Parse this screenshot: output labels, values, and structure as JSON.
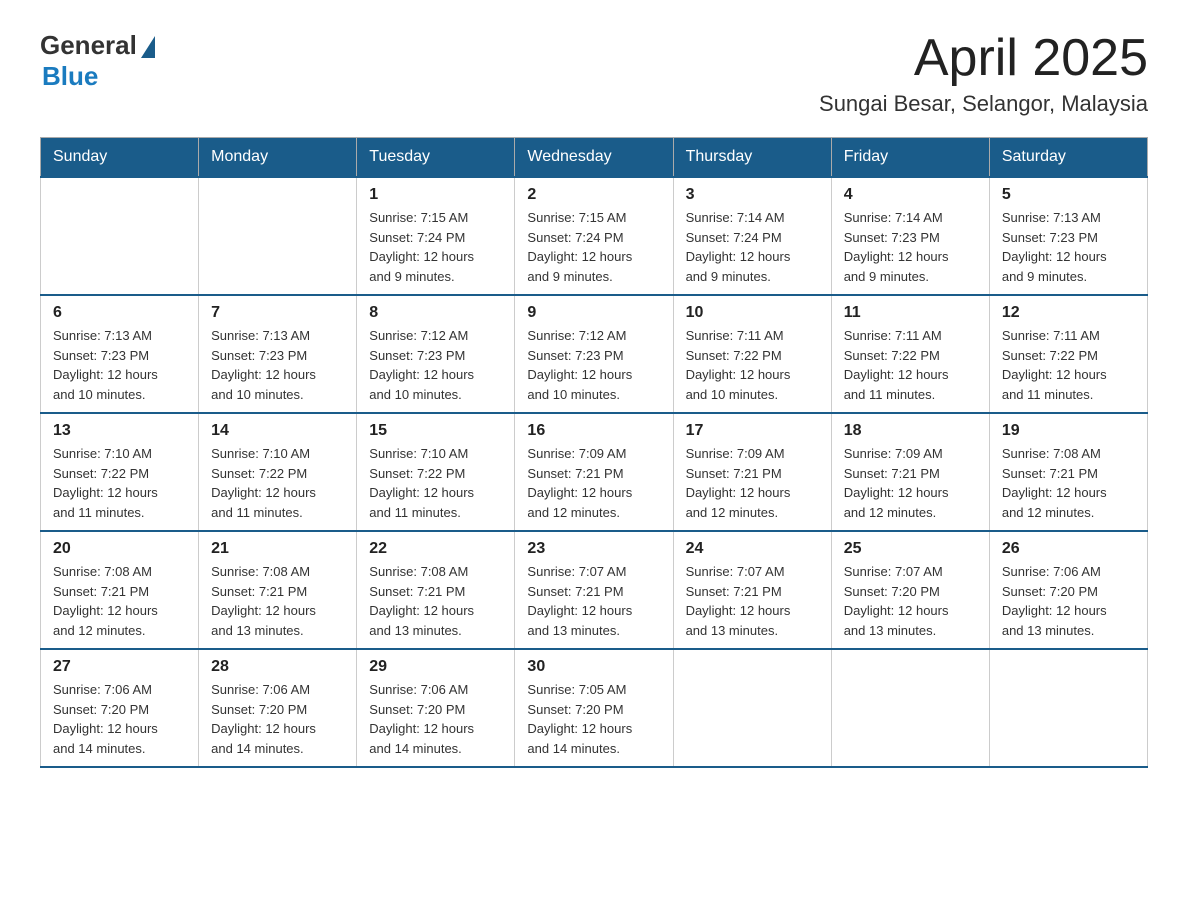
{
  "header": {
    "logo": {
      "general": "General",
      "blue": "Blue"
    },
    "title": "April 2025",
    "location": "Sungai Besar, Selangor, Malaysia"
  },
  "weekdays": [
    "Sunday",
    "Monday",
    "Tuesday",
    "Wednesday",
    "Thursday",
    "Friday",
    "Saturday"
  ],
  "weeks": [
    [
      {
        "day": "",
        "info": ""
      },
      {
        "day": "",
        "info": ""
      },
      {
        "day": "1",
        "info": "Sunrise: 7:15 AM\nSunset: 7:24 PM\nDaylight: 12 hours\nand 9 minutes."
      },
      {
        "day": "2",
        "info": "Sunrise: 7:15 AM\nSunset: 7:24 PM\nDaylight: 12 hours\nand 9 minutes."
      },
      {
        "day": "3",
        "info": "Sunrise: 7:14 AM\nSunset: 7:24 PM\nDaylight: 12 hours\nand 9 minutes."
      },
      {
        "day": "4",
        "info": "Sunrise: 7:14 AM\nSunset: 7:23 PM\nDaylight: 12 hours\nand 9 minutes."
      },
      {
        "day": "5",
        "info": "Sunrise: 7:13 AM\nSunset: 7:23 PM\nDaylight: 12 hours\nand 9 minutes."
      }
    ],
    [
      {
        "day": "6",
        "info": "Sunrise: 7:13 AM\nSunset: 7:23 PM\nDaylight: 12 hours\nand 10 minutes."
      },
      {
        "day": "7",
        "info": "Sunrise: 7:13 AM\nSunset: 7:23 PM\nDaylight: 12 hours\nand 10 minutes."
      },
      {
        "day": "8",
        "info": "Sunrise: 7:12 AM\nSunset: 7:23 PM\nDaylight: 12 hours\nand 10 minutes."
      },
      {
        "day": "9",
        "info": "Sunrise: 7:12 AM\nSunset: 7:23 PM\nDaylight: 12 hours\nand 10 minutes."
      },
      {
        "day": "10",
        "info": "Sunrise: 7:11 AM\nSunset: 7:22 PM\nDaylight: 12 hours\nand 10 minutes."
      },
      {
        "day": "11",
        "info": "Sunrise: 7:11 AM\nSunset: 7:22 PM\nDaylight: 12 hours\nand 11 minutes."
      },
      {
        "day": "12",
        "info": "Sunrise: 7:11 AM\nSunset: 7:22 PM\nDaylight: 12 hours\nand 11 minutes."
      }
    ],
    [
      {
        "day": "13",
        "info": "Sunrise: 7:10 AM\nSunset: 7:22 PM\nDaylight: 12 hours\nand 11 minutes."
      },
      {
        "day": "14",
        "info": "Sunrise: 7:10 AM\nSunset: 7:22 PM\nDaylight: 12 hours\nand 11 minutes."
      },
      {
        "day": "15",
        "info": "Sunrise: 7:10 AM\nSunset: 7:22 PM\nDaylight: 12 hours\nand 11 minutes."
      },
      {
        "day": "16",
        "info": "Sunrise: 7:09 AM\nSunset: 7:21 PM\nDaylight: 12 hours\nand 12 minutes."
      },
      {
        "day": "17",
        "info": "Sunrise: 7:09 AM\nSunset: 7:21 PM\nDaylight: 12 hours\nand 12 minutes."
      },
      {
        "day": "18",
        "info": "Sunrise: 7:09 AM\nSunset: 7:21 PM\nDaylight: 12 hours\nand 12 minutes."
      },
      {
        "day": "19",
        "info": "Sunrise: 7:08 AM\nSunset: 7:21 PM\nDaylight: 12 hours\nand 12 minutes."
      }
    ],
    [
      {
        "day": "20",
        "info": "Sunrise: 7:08 AM\nSunset: 7:21 PM\nDaylight: 12 hours\nand 12 minutes."
      },
      {
        "day": "21",
        "info": "Sunrise: 7:08 AM\nSunset: 7:21 PM\nDaylight: 12 hours\nand 13 minutes."
      },
      {
        "day": "22",
        "info": "Sunrise: 7:08 AM\nSunset: 7:21 PM\nDaylight: 12 hours\nand 13 minutes."
      },
      {
        "day": "23",
        "info": "Sunrise: 7:07 AM\nSunset: 7:21 PM\nDaylight: 12 hours\nand 13 minutes."
      },
      {
        "day": "24",
        "info": "Sunrise: 7:07 AM\nSunset: 7:21 PM\nDaylight: 12 hours\nand 13 minutes."
      },
      {
        "day": "25",
        "info": "Sunrise: 7:07 AM\nSunset: 7:20 PM\nDaylight: 12 hours\nand 13 minutes."
      },
      {
        "day": "26",
        "info": "Sunrise: 7:06 AM\nSunset: 7:20 PM\nDaylight: 12 hours\nand 13 minutes."
      }
    ],
    [
      {
        "day": "27",
        "info": "Sunrise: 7:06 AM\nSunset: 7:20 PM\nDaylight: 12 hours\nand 14 minutes."
      },
      {
        "day": "28",
        "info": "Sunrise: 7:06 AM\nSunset: 7:20 PM\nDaylight: 12 hours\nand 14 minutes."
      },
      {
        "day": "29",
        "info": "Sunrise: 7:06 AM\nSunset: 7:20 PM\nDaylight: 12 hours\nand 14 minutes."
      },
      {
        "day": "30",
        "info": "Sunrise: 7:05 AM\nSunset: 7:20 PM\nDaylight: 12 hours\nand 14 minutes."
      },
      {
        "day": "",
        "info": ""
      },
      {
        "day": "",
        "info": ""
      },
      {
        "day": "",
        "info": ""
      }
    ]
  ]
}
